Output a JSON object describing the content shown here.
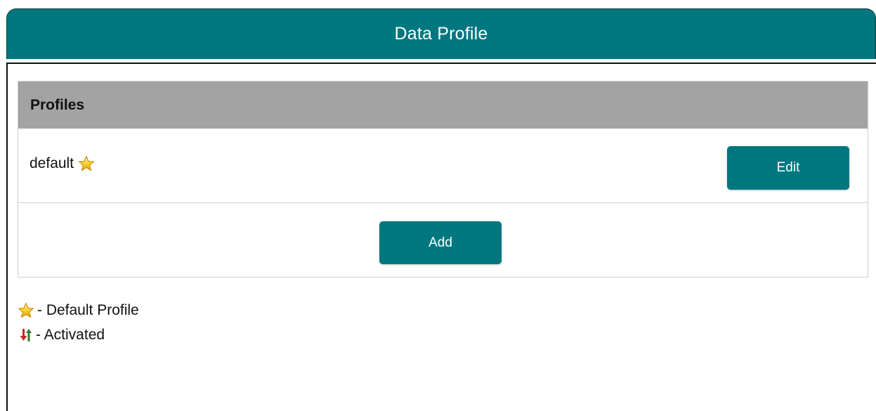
{
  "header": {
    "title": "Data Profile",
    "color": "#00777f"
  },
  "panel": {
    "heading": "Profiles",
    "profiles": [
      {
        "name": "default",
        "is_default": true,
        "edit_label": "Edit"
      }
    ],
    "add_label": "Add"
  },
  "legend": {
    "items": [
      {
        "icon": "star-icon",
        "label": "- Default Profile"
      },
      {
        "icon": "activated-icon",
        "label": "- Activated"
      }
    ]
  },
  "colors": {
    "accent": "#00777f",
    "panel_heading_bg": "#a3a3a3",
    "star": "#f5c518"
  }
}
